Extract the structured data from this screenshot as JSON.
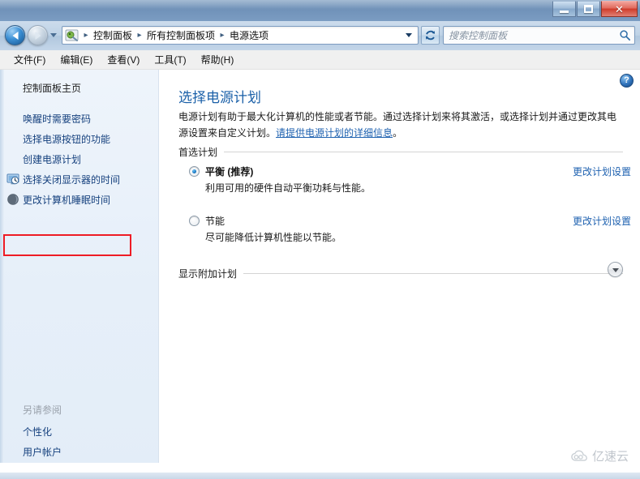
{
  "window": {
    "controls": {
      "minimize_label": "最小化",
      "maximize_label": "最大化",
      "close_label": "关闭"
    }
  },
  "navbar": {
    "back_label": "后退",
    "forward_label": "前进",
    "refresh_label": "刷新",
    "breadcrumbs": [
      "控制面板",
      "所有控制面板项",
      "电源选项"
    ],
    "separator": "▸",
    "search": {
      "placeholder": "搜索控制面板",
      "value": ""
    }
  },
  "menubar": {
    "items": [
      {
        "label": "文件(F)"
      },
      {
        "label": "编辑(E)"
      },
      {
        "label": "查看(V)"
      },
      {
        "label": "工具(T)"
      },
      {
        "label": "帮助(H)"
      }
    ]
  },
  "sidebar": {
    "home_label": "控制面板主页",
    "items": [
      {
        "label": "唤醒时需要密码",
        "icon": ""
      },
      {
        "label": "选择电源按钮的功能",
        "icon": ""
      },
      {
        "label": "创建电源计划",
        "icon": ""
      },
      {
        "label": "选择关闭显示器的时间",
        "icon": "monitor-clock-icon",
        "highlighted": true
      },
      {
        "label": "更改计算机睡眠时间",
        "icon": "moon-sleep-icon"
      }
    ],
    "see_also_title": "另请参阅",
    "see_also_items": [
      {
        "label": "个性化"
      },
      {
        "label": "用户帐户"
      }
    ]
  },
  "main": {
    "help_glyph": "?",
    "title": "选择电源计划",
    "description_part1": "电源计划有助于最大化计算机的性能或者节能。通过选择计划来将其激活，或选择计划并通过更改其电源设置来自定义计划。",
    "description_link": "请提供电源计划的详细信息",
    "description_part2": "。",
    "preferred_section_label": "首选计划",
    "plans": [
      {
        "name": "平衡 (推荐)",
        "description": "利用可用的硬件自动平衡功耗与性能。",
        "selected": true,
        "link_label": "更改计划设置"
      },
      {
        "name": "节能",
        "description": "尽可能降低计算机性能以节能。",
        "selected": false,
        "link_label": "更改计划设置"
      }
    ],
    "more_section_label": "显示附加计划",
    "more_chevron_icon": "chevron-down-icon"
  },
  "watermark": {
    "text": "亿速云",
    "icon": "cloud-icon"
  },
  "colors": {
    "title_accent": "#1b60a8",
    "link": "#1f62b0",
    "highlight_border": "#ee1c25",
    "sidebar_bg": "#e6eff9",
    "titlebar": "#7b9cc2"
  }
}
